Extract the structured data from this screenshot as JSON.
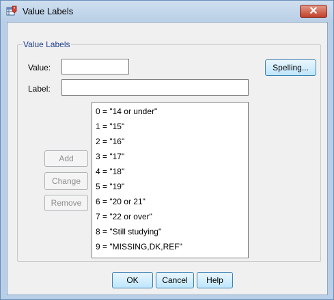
{
  "window": {
    "title": "Value Labels",
    "close_label": "✕"
  },
  "group": {
    "title": "Value Labels"
  },
  "fields": {
    "value_label": "Value:",
    "value_value": "",
    "label_label": "Label:",
    "label_value": ""
  },
  "buttons": {
    "spelling": "Spelling...",
    "add": "Add",
    "change": "Change",
    "remove": "Remove",
    "ok": "OK",
    "cancel": "Cancel",
    "help": "Help"
  },
  "value_labels": [
    "0 = \"14 or under\"",
    "1 = \"15\"",
    "2 = \"16\"",
    "3 = \"17\"",
    "4 = \"18\"",
    "5 = \"19\"",
    "6 = \"20 or 21\"",
    "7 = \"22 or over\"",
    "8 = \"Still studying\"",
    "9 = \"MISSING,DK,REF\""
  ],
  "colors": {
    "title_bar": "#b8cfe7",
    "close_button": "#c1412b",
    "group_title": "#1a3d8f",
    "primary_button": "#bee6fd"
  }
}
